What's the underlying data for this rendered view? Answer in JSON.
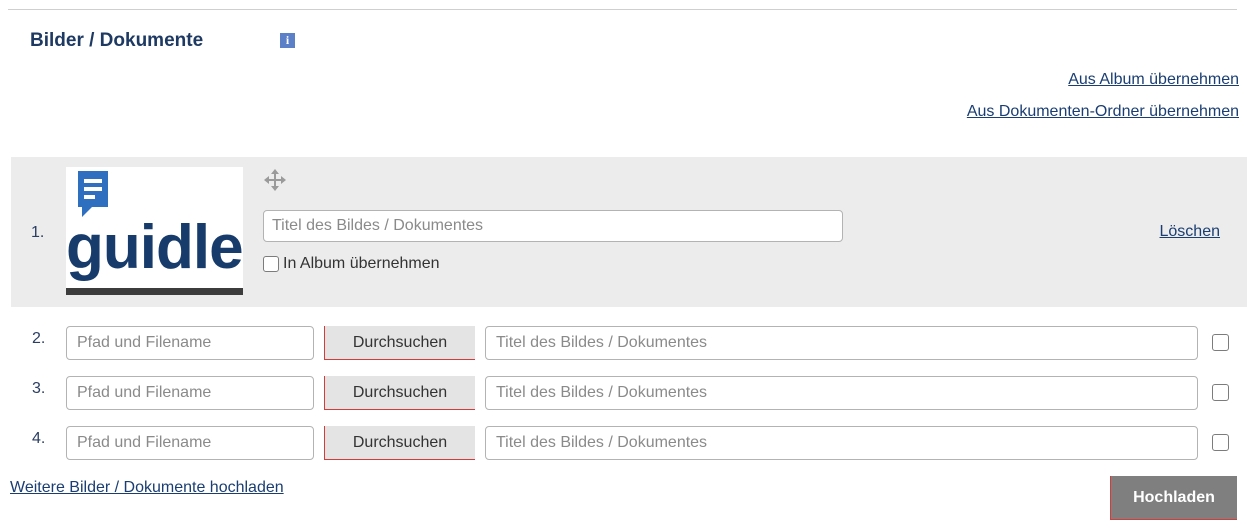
{
  "section": {
    "title": "Bilder / Dokumente",
    "info_icon": "i"
  },
  "links": {
    "from_album": "Aus Album übernehmen",
    "from_documents": "Aus Dokumenten-Ordner übernehmen",
    "more_uploads": "Weitere Bilder / Dokumente hochladen"
  },
  "existing_item": {
    "number": "1.",
    "logo_text": "guidle",
    "title_placeholder": "Titel des Bildes / Dokumentes",
    "title_value": "",
    "album_checkbox_label": "In Album übernehmen",
    "album_checkbox_checked": false,
    "delete_label": "Löschen"
  },
  "upload_rows": [
    {
      "number": "2.",
      "path_placeholder": "Pfad und Filename",
      "browse_label": "Durchsuchen",
      "title_placeholder": "Titel des Bildes / Dokumentes",
      "checked": false
    },
    {
      "number": "3.",
      "path_placeholder": "Pfad und Filename",
      "browse_label": "Durchsuchen",
      "title_placeholder": "Titel des Bildes / Dokumentes",
      "checked": false
    },
    {
      "number": "4.",
      "path_placeholder": "Pfad und Filename",
      "browse_label": "Durchsuchen",
      "title_placeholder": "Titel des Bildes / Dokumentes",
      "checked": false
    }
  ],
  "upload_button": {
    "label": "Hochladen"
  },
  "colors": {
    "title": "#1e3a63",
    "link": "#1a3e73",
    "row_bg": "#ececec",
    "info_icon": "#5b80c7",
    "upload_button": "#7f7f7f"
  },
  "icons": {
    "info": "info-icon",
    "move": "move-icon",
    "logo": "guidle-logo"
  }
}
